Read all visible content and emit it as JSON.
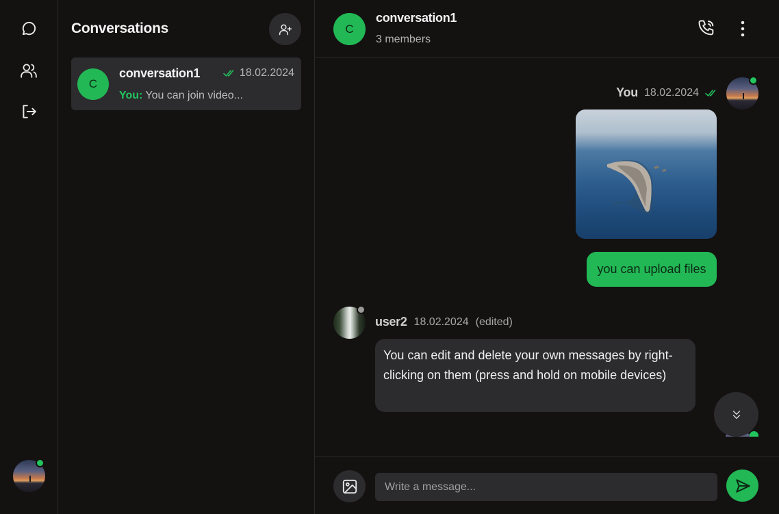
{
  "rail": {
    "icons": [
      "chat-bubble-icon",
      "users-icon",
      "logout-icon"
    ]
  },
  "conversations": {
    "title": "Conversations",
    "items": [
      {
        "initial": "C",
        "name": "conversation1",
        "date": "18.02.2024",
        "last_sender": "You:",
        "last_message": "You can join video..."
      }
    ]
  },
  "chat": {
    "header": {
      "initial": "C",
      "name": "conversation1",
      "subtitle": "3 members"
    },
    "messages": [
      {
        "author": "You",
        "date": "18.02.2024",
        "image_alt": "aerial island photo",
        "text": "you can upload files"
      },
      {
        "author": "user2",
        "date": "18.02.2024",
        "edited": "(edited)",
        "text": "You can edit and delete your own messages by right-clicking on them (press and hold on mobile devices)"
      }
    ],
    "composer": {
      "placeholder": "Write a message..."
    }
  },
  "colors": {
    "background": "#141111",
    "surface": "#2c2b2e",
    "accent": "#22b855",
    "online": "#22c55e"
  }
}
